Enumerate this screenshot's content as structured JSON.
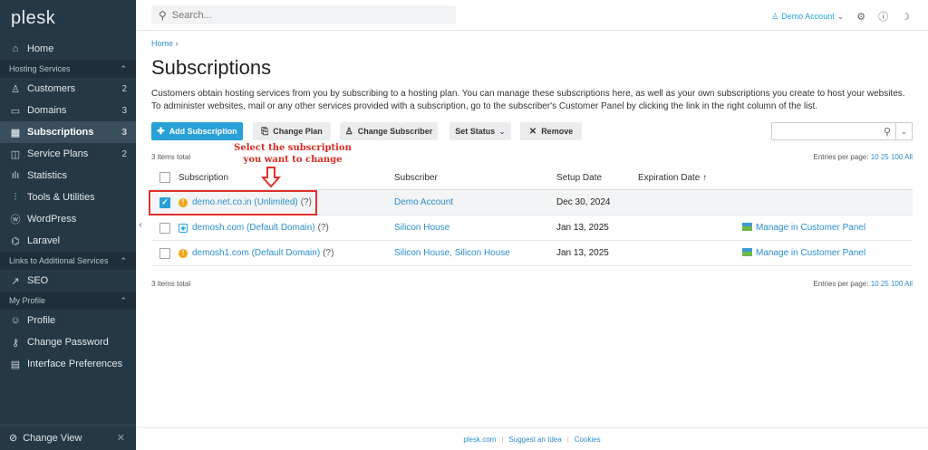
{
  "sidebar": {
    "logo": "plesk",
    "home": {
      "label": "Home",
      "icon": "home-icon"
    },
    "sections": [
      {
        "title": "Hosting Services",
        "items": [
          {
            "label": "Customers",
            "count": "2",
            "icon": "user-icon"
          },
          {
            "label": "Domains",
            "count": "3",
            "icon": "monitor-icon"
          },
          {
            "label": "Subscriptions",
            "count": "3",
            "icon": "grid-icon",
            "active": true
          },
          {
            "label": "Service Plans",
            "count": "2",
            "icon": "book-icon"
          },
          {
            "label": "Statistics",
            "count": "",
            "icon": "bar-chart-icon"
          },
          {
            "label": "Tools & Utilities",
            "count": "",
            "icon": "sliders-icon"
          },
          {
            "label": "WordPress",
            "count": "",
            "icon": "wordpress-icon"
          },
          {
            "label": "Laravel",
            "count": "",
            "icon": "laravel-icon"
          }
        ]
      },
      {
        "title": "Links to Additional Services",
        "items": [
          {
            "label": "SEO",
            "count": "",
            "icon": "seo-icon"
          }
        ]
      },
      {
        "title": "My Profile",
        "items": [
          {
            "label": "Profile",
            "count": "",
            "icon": "profile-icon"
          },
          {
            "label": "Change Password",
            "count": "",
            "icon": "key-icon"
          },
          {
            "label": "Interface Preferences",
            "count": "",
            "icon": "preferences-icon"
          }
        ]
      }
    ],
    "bottom": {
      "label": "Change View",
      "icon": "change-view-icon"
    }
  },
  "header": {
    "search_placeholder": "Search...",
    "account": "Demo Account"
  },
  "breadcrumb": "Home",
  "page_title": "Subscriptions",
  "description": "Customers obtain hosting services from you by subscribing to a hosting plan. You can manage these subscriptions here, as well as your own subscriptions you create to host your websites. To administer websites, mail or any other services provided with a subscription, go to the subscriber's Customer Panel by clicking the link in the right column of the list.",
  "toolbar": {
    "add": "Add Subscription",
    "change_plan": "Change Plan",
    "change_subscriber": "Change Subscriber",
    "set_status": "Set Status",
    "remove": "Remove"
  },
  "list_info": {
    "items_total": "3 items total",
    "entries_label": "Entries per page:",
    "pp_10": "10",
    "pp_25": "25",
    "pp_100": "100",
    "pp_all": "All"
  },
  "table": {
    "columns": [
      "Subscription",
      "Subscriber",
      "Setup Date",
      "Expiration Date ↑"
    ],
    "rows": [
      {
        "subscription": "demo.net.co.in (Unlimited)",
        "help": "(?)",
        "subscriber": "Demo Account",
        "subscriber_extra": "",
        "setup_date": "Dec 30, 2024",
        "action": "",
        "checked": true,
        "status_icon": "warning-icon"
      },
      {
        "subscription": "demosh.com (Default Domain)",
        "help": "(?)",
        "subscriber": "Silicon House",
        "subscriber_extra": "",
        "setup_date": "Jan 13, 2025",
        "action": "Manage in Customer Panel",
        "checked": false,
        "status_icon": "domain-icon"
      },
      {
        "subscription": "demosh1.com (Default Domain)",
        "help": "(?)",
        "subscriber": "Silicon House",
        "subscriber_extra": ", Silicon House",
        "setup_date": "Jan 13, 2025",
        "action": "Manage in Customer Panel",
        "checked": false,
        "status_icon": "warning-icon"
      }
    ]
  },
  "annotation": {
    "line1": "Select the subscription",
    "line2": "you want to change",
    "color": "#d62b23"
  },
  "footer": {
    "link1": "plesk.com",
    "link2": "Suggest an Idea",
    "link3": "Cookies"
  },
  "colors": {
    "accent": "#28a0d8",
    "sidebar": "#253845",
    "warning": "#f1a516"
  }
}
